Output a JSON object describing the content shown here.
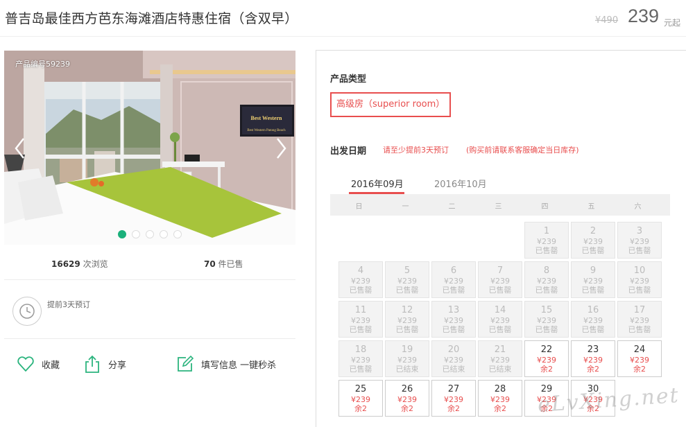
{
  "header": {
    "title": "普吉岛最佳西方芭东海滩酒店特惠住宿（含双早）",
    "original_price": "¥490",
    "price": "239",
    "price_unit": "元起"
  },
  "gallery": {
    "product_no": "产品编号59239",
    "photo_sign_brand": "Best Western",
    "photo_sign_sub": "Best Western Patong Beach",
    "slide_count": 5,
    "active_slide": 1
  },
  "stats": {
    "views_count": "16629",
    "views_label": "次浏览",
    "sold_count": "70",
    "sold_label": "件已售"
  },
  "advance": {
    "text": "提前3天预订"
  },
  "actions": {
    "favorite": "收藏",
    "share": "分享",
    "book": "填写信息 一键秒杀"
  },
  "panel": {
    "type_label": "产品类型",
    "room_option": "高级房（superior room）",
    "date_label": "出发日期",
    "notice": "请至少提前3天预订",
    "notice2": "(购买前请联系客服确定当日库存)",
    "months": [
      "2016年09月",
      "2016年10月"
    ],
    "weekdays": [
      "日",
      "一",
      "二",
      "三",
      "四",
      "五",
      "六"
    ],
    "days": [
      {
        "d": "1",
        "p": "¥239",
        "s": "已售罄",
        "on": false
      },
      {
        "d": "2",
        "p": "¥239",
        "s": "已售罄",
        "on": false
      },
      {
        "d": "3",
        "p": "¥239",
        "s": "已售罄",
        "on": false
      },
      {
        "d": "4",
        "p": "¥239",
        "s": "已售罄",
        "on": false
      },
      {
        "d": "5",
        "p": "¥239",
        "s": "已售罄",
        "on": false
      },
      {
        "d": "6",
        "p": "¥239",
        "s": "已售罄",
        "on": false
      },
      {
        "d": "7",
        "p": "¥239",
        "s": "已售罄",
        "on": false
      },
      {
        "d": "8",
        "p": "¥239",
        "s": "已售罄",
        "on": false
      },
      {
        "d": "9",
        "p": "¥239",
        "s": "已售罄",
        "on": false
      },
      {
        "d": "10",
        "p": "¥239",
        "s": "已售罄",
        "on": false
      },
      {
        "d": "11",
        "p": "¥239",
        "s": "已售罄",
        "on": false
      },
      {
        "d": "12",
        "p": "¥239",
        "s": "已售罄",
        "on": false
      },
      {
        "d": "13",
        "p": "¥239",
        "s": "已售罄",
        "on": false
      },
      {
        "d": "14",
        "p": "¥239",
        "s": "已售罄",
        "on": false
      },
      {
        "d": "15",
        "p": "¥239",
        "s": "已售罄",
        "on": false
      },
      {
        "d": "16",
        "p": "¥239",
        "s": "已售罄",
        "on": false
      },
      {
        "d": "17",
        "p": "¥239",
        "s": "已售罄",
        "on": false
      },
      {
        "d": "18",
        "p": "¥239",
        "s": "已售罄",
        "on": false
      },
      {
        "d": "19",
        "p": "¥239",
        "s": "已结束",
        "on": false
      },
      {
        "d": "20",
        "p": "¥239",
        "s": "已结束",
        "on": false
      },
      {
        "d": "21",
        "p": "¥239",
        "s": "已结束",
        "on": false
      },
      {
        "d": "22",
        "p": "¥239",
        "s": "余2",
        "on": true
      },
      {
        "d": "23",
        "p": "¥239",
        "s": "余2",
        "on": true
      },
      {
        "d": "24",
        "p": "¥239",
        "s": "余2",
        "on": true
      },
      {
        "d": "25",
        "p": "¥239",
        "s": "余2",
        "on": true
      },
      {
        "d": "26",
        "p": "¥239",
        "s": "余2",
        "on": true
      },
      {
        "d": "27",
        "p": "¥239",
        "s": "余2",
        "on": true
      },
      {
        "d": "28",
        "p": "¥239",
        "s": "余2",
        "on": true
      },
      {
        "d": "29",
        "p": "¥239",
        "s": "余2",
        "on": true
      },
      {
        "d": "30",
        "p": "¥239",
        "s": "余2",
        "on": true
      }
    ],
    "first_weekday": 4
  },
  "watermark": "eLvXing.net",
  "colors": {
    "accent": "#e84e4e",
    "active_dot": "#1bb07b",
    "icon_green": "#2bb47e"
  }
}
